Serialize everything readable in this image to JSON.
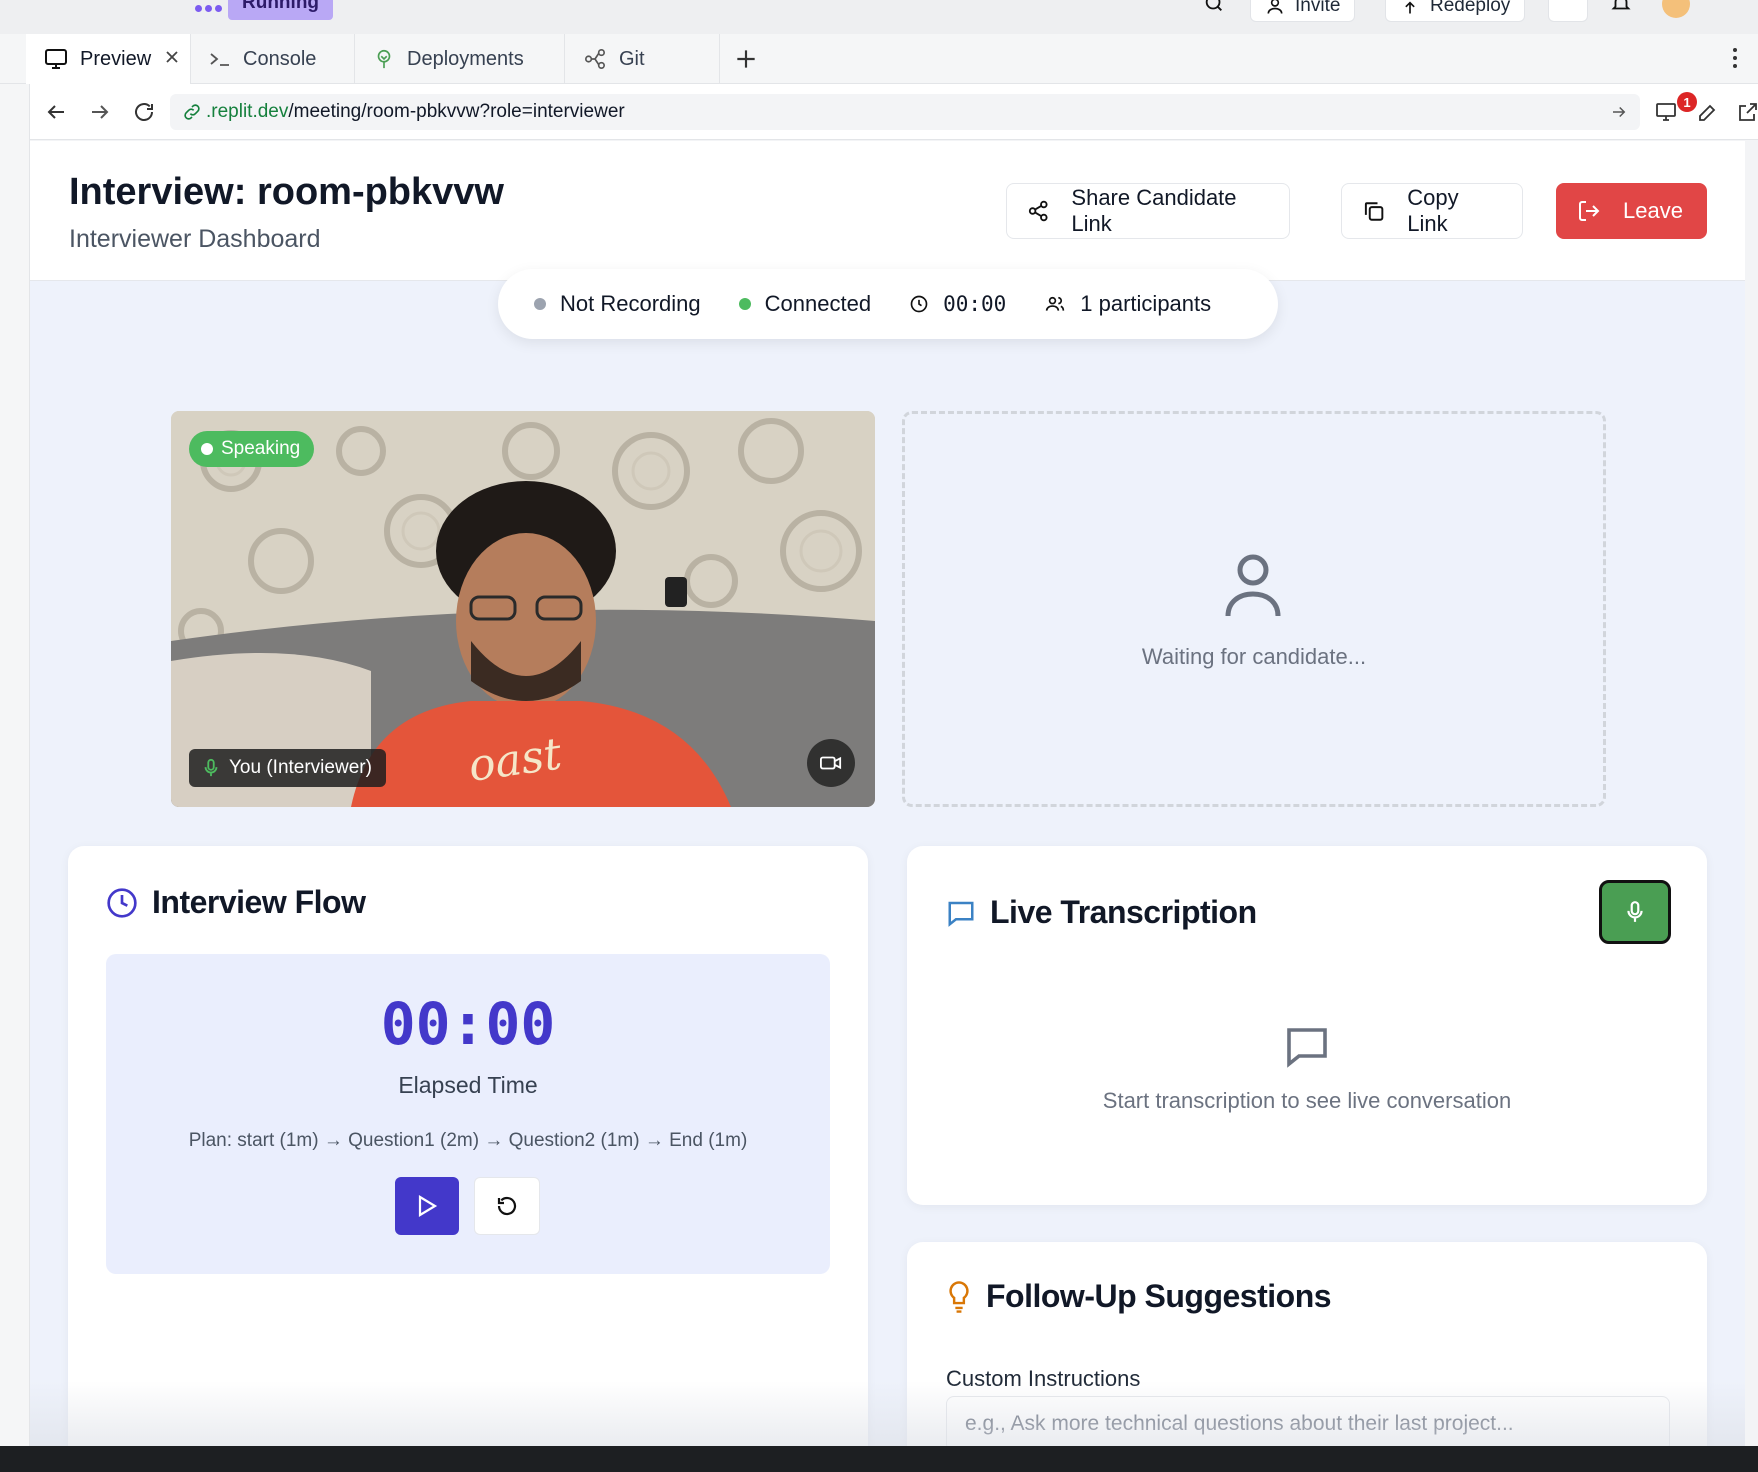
{
  "toolbar": {
    "run_label": "Running",
    "invite_label": "Invite",
    "redeploy_label": "Redeploy"
  },
  "tabs": [
    {
      "label": "Preview",
      "icon": "monitor-icon",
      "active": true
    },
    {
      "label": "Console",
      "icon": "terminal-icon"
    },
    {
      "label": "Deployments",
      "icon": "deploy-icon"
    },
    {
      "label": "Git",
      "icon": "git-icon"
    }
  ],
  "address": {
    "domain": ".replit.dev",
    "path": "/meeting/room-pbkvvw?role=interviewer",
    "badge_count": "1"
  },
  "header": {
    "title": "Interview: room-pbkvvw",
    "subtitle": "Interviewer Dashboard",
    "share_label": "Share Candidate Link",
    "copy_label": "Copy Link",
    "leave_label": "Leave"
  },
  "status": {
    "recording": "Not Recording",
    "connection": "Connected",
    "timer": "00:00",
    "participants": "1 participants",
    "colors": {
      "recording_dot": "#9ca3af",
      "connected_dot": "#4dbb5f"
    }
  },
  "video": {
    "speaking_label": "Speaking",
    "name_label": "You (Interviewer)"
  },
  "candidate": {
    "waiting_text": "Waiting for candidate..."
  },
  "flow": {
    "title": "Interview Flow",
    "elapsed_value": "00:00",
    "elapsed_label": "Elapsed Time",
    "plan": "Plan: start (1m) → Question1 (2m) → Question2 (1m) → End (1m)"
  },
  "transcription": {
    "title": "Live Transcription",
    "empty_text": "Start transcription to see live conversation"
  },
  "suggestions": {
    "title": "Follow-Up Suggestions",
    "custom_label": "Custom Instructions",
    "placeholder": "e.g., Ask more technical questions about their last project..."
  },
  "colors": {
    "accent": "#4338ca",
    "leave": "#e14646",
    "mic": "#4a9e53"
  }
}
